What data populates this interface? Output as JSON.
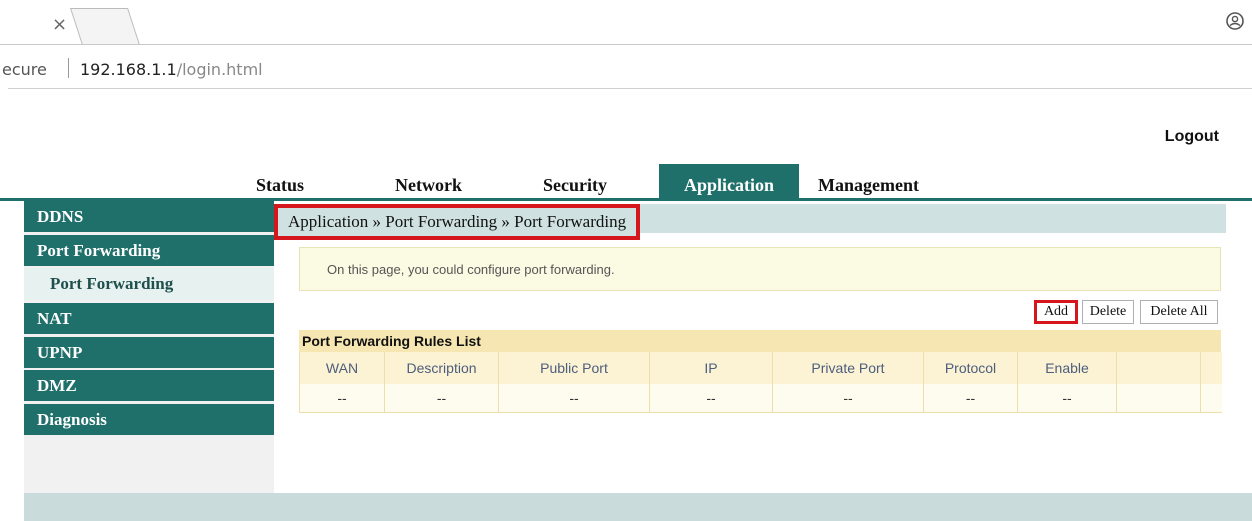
{
  "browser": {
    "tab_close": "×",
    "address_secure": "ecure",
    "address_host": "192.168.1.1",
    "address_path": "/login.html"
  },
  "header": {
    "logout": "Logout"
  },
  "topnav": {
    "tabs": [
      {
        "label": "Status"
      },
      {
        "label": "Network"
      },
      {
        "label": "Security"
      },
      {
        "label": "Application"
      },
      {
        "label": "Management"
      }
    ],
    "active": "Application"
  },
  "sidebar": {
    "items": [
      {
        "label": "DDNS"
      },
      {
        "label": "Port Forwarding"
      },
      {
        "label": "Port Forwarding"
      },
      {
        "label": "NAT"
      },
      {
        "label": "UPNP"
      },
      {
        "label": "DMZ"
      },
      {
        "label": "Diagnosis"
      }
    ]
  },
  "main": {
    "breadcrumb": "Application » Port Forwarding » Port Forwarding",
    "info": "On this page, you could configure port forwarding.",
    "buttons": {
      "add": "Add",
      "delete": "Delete",
      "delete_all": "Delete All"
    },
    "rules_title": "Port Forwarding Rules List",
    "columns": [
      "WAN",
      "Description",
      "Public Port",
      "IP",
      "Private Port",
      "Protocol",
      "Enable",
      "",
      ""
    ],
    "row": [
      "--",
      "--",
      "--",
      "--",
      "--",
      "--",
      "--",
      "",
      ""
    ]
  },
  "colors": {
    "accent": "#1f6f6a",
    "highlight": "#d6161d",
    "breadcrumb_bg": "#cfe2e1",
    "info_bg": "#fbfbe3",
    "table_header_bg": "#f6e7b2"
  }
}
